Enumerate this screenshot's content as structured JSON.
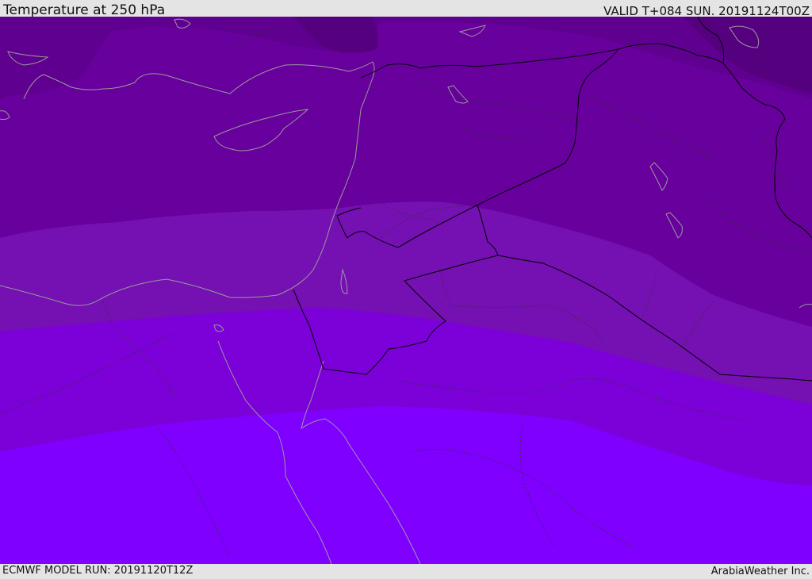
{
  "header": {
    "title": "Temperature at 250 hPa",
    "valid": "VALID T+084 SUN. 20191124T00Z"
  },
  "footer": {
    "model_run": "ECMWF MODEL RUN: 20191120T12Z",
    "credit": "ArabiaWeather Inc."
  },
  "map": {
    "field": "temperature-250hPa",
    "colors": {
      "band_darkest": "#55007f",
      "band_dark": "#5f0090",
      "band_mid_dark": "#67009c",
      "band_mid": "#7510b2",
      "band_light": "#7c00d8",
      "band_lightest": "#7f00ff",
      "coastline": "#9a9a9a",
      "border": "#000000",
      "province_border": "#333333"
    }
  }
}
